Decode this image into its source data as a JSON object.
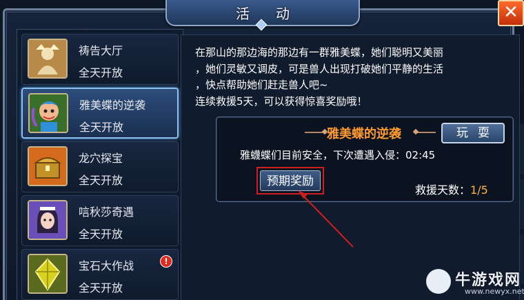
{
  "window": {
    "title": "活动",
    "close_label": "✕"
  },
  "sidebar": {
    "items": [
      {
        "name": "祷告大厅",
        "status": "全天开放",
        "icon": "prayer-hall-icon",
        "selected": false,
        "has_badge": false
      },
      {
        "name": "雅美蝶的逆袭",
        "status": "全天开放",
        "icon": "yameidie-icon",
        "selected": true,
        "has_badge": false
      },
      {
        "name": "龙穴探宝",
        "status": "全天开放",
        "icon": "treasure-chest-icon",
        "selected": false,
        "has_badge": false
      },
      {
        "name": "唁秋莎奇遇",
        "status": "全天开放",
        "icon": "girl-portrait-icon",
        "selected": false,
        "has_badge": false
      },
      {
        "name": "宝石大作战",
        "status": "全天开放",
        "icon": "gem-icon",
        "selected": false,
        "has_badge": true
      }
    ],
    "badge_label": "!"
  },
  "content": {
    "description_lines": [
      "在那山的那边海的那边有一群雅美蝶，她们聪明又美丽",
      "，她们灵敏又调皮，可是兽人出现打破她们平静的生活",
      "，快点帮助她们赶走兽人吧~",
      "连续救援5天，可以获得惊喜奖励哦！"
    ],
    "event": {
      "title": "雅美蝶的逆袭",
      "play_label": "玩耍",
      "status_text": "雅蠛蝶们目前安全，下次遭遇入侵：02:45",
      "reward_label": "预期奖励",
      "rescue_label": "救援天数：",
      "rescue_value": "1/5"
    }
  },
  "watermark": {
    "text": "牛游戏网",
    "url": "www.newyx.net"
  },
  "colors": {
    "accent_orange": "#ff9b2e",
    "value_orange": "#ffb347",
    "highlight_red": "#d11f1f",
    "selected_border": "#8cc0ee"
  }
}
